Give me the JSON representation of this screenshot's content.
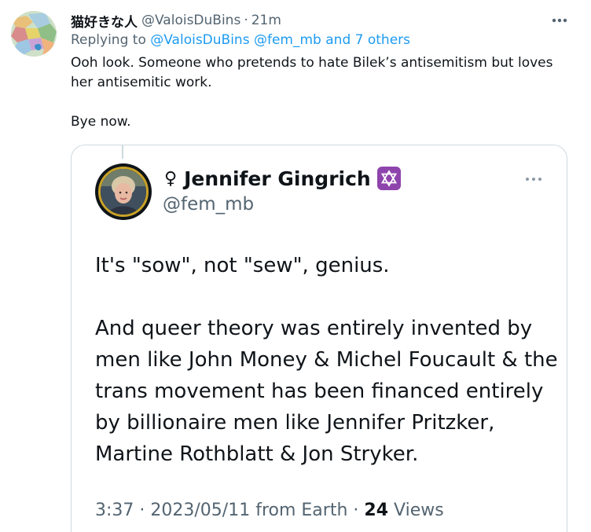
{
  "tweet": {
    "display_name": "猫好きな人",
    "handle": "@ValoisDuBins",
    "separator": "·",
    "timestamp": "21m",
    "more_icon": "more-horizontal-icon",
    "replying_prefix": "Replying to",
    "replying_to": [
      "@ValoisDuBins",
      "@fem_mb"
    ],
    "replying_others": "and 7 others",
    "text_lines": [
      "Ooh look. Someone who pretends to hate Bilek’s antisemitism but loves her antisemitic work.",
      "Bye now."
    ]
  },
  "quoted": {
    "gender_symbol": "♀",
    "name": "Jennifer Gingrich",
    "badge_icon": "star-of-david-icon",
    "handle": "@fem_mb",
    "more_icon": "more-horizontal-icon",
    "paragraphs": [
      "It's \"sow\", not \"sew\", genius.",
      "And queer theory was entirely invented by men like John Money & Michel Foucault & the trans movement has been financed entirely by billionaire men like Jennifer Pritzker, Martine Rothblatt & Jon Stryker."
    ],
    "time": "3:37",
    "date": "2023/05/11 from Earth",
    "meta_sep1": "·",
    "meta_sep2": "·",
    "views_count": "24",
    "views_label": "Views"
  },
  "colors": {
    "text": "#0f1419",
    "secondary": "#536471",
    "link": "#1d9bf0",
    "border": "#cfd9de",
    "badge": "#8e44ad"
  }
}
